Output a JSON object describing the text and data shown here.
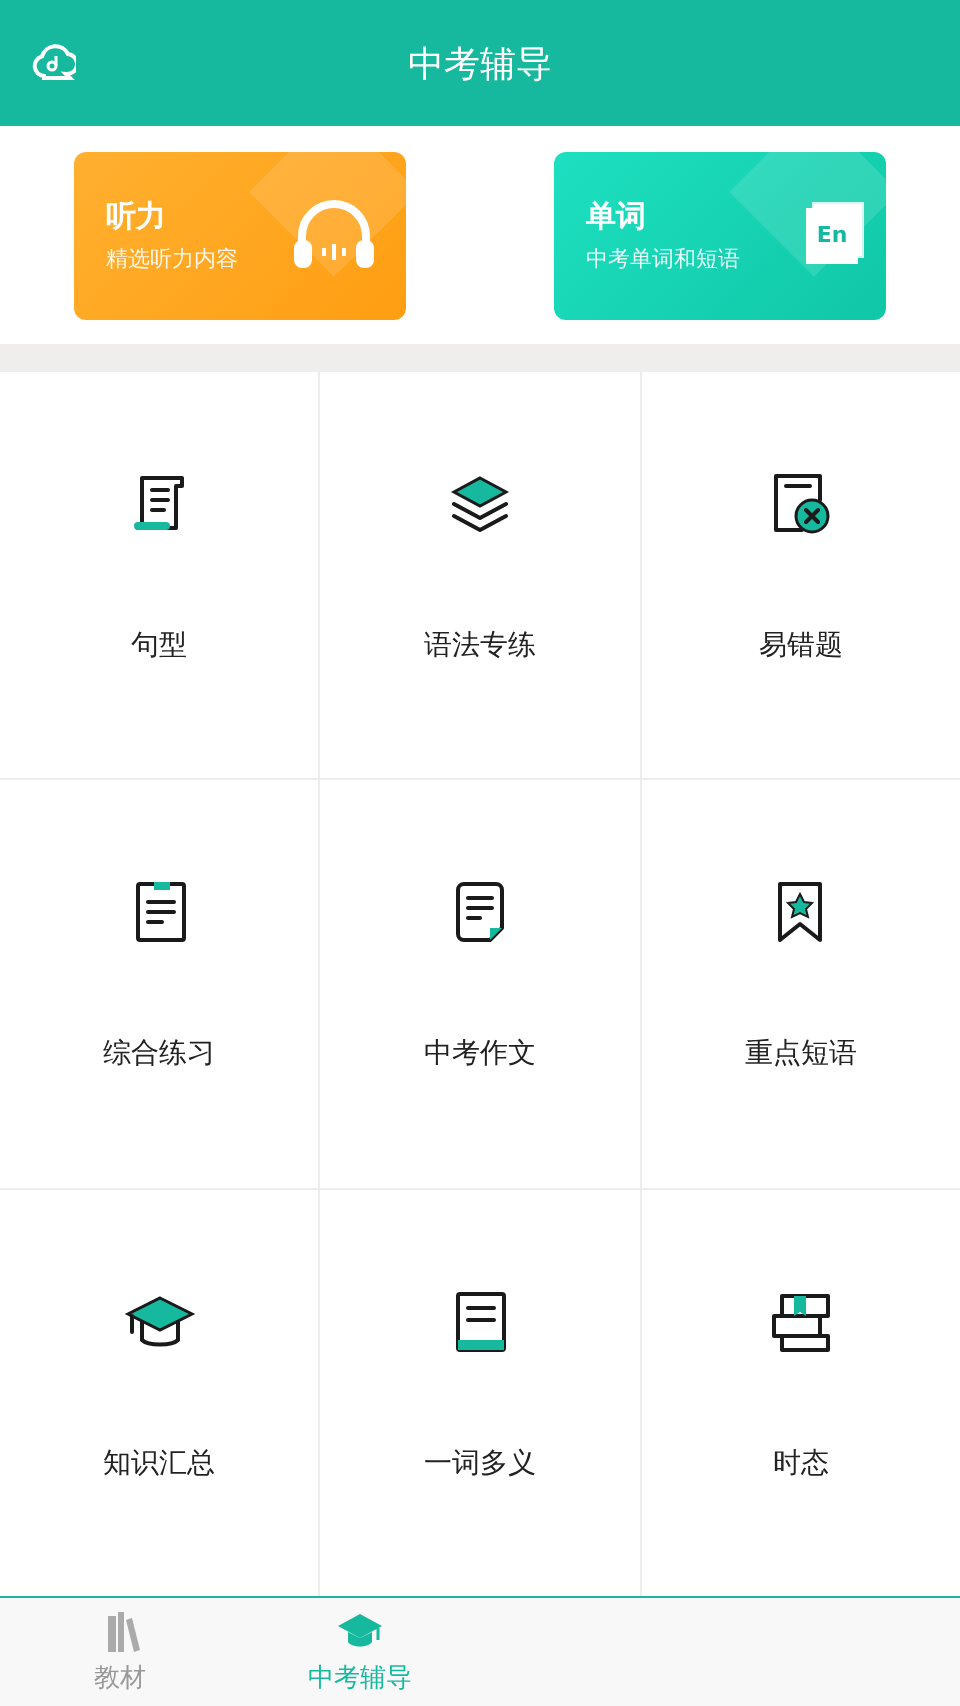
{
  "header": {
    "title": "中考辅导"
  },
  "feature_cards": [
    {
      "kind": "listening",
      "title": "听力",
      "subtitle": "精选听力内容"
    },
    {
      "kind": "words",
      "title": "单词",
      "subtitle": "中考单词和短语",
      "badge": "En"
    }
  ],
  "grid_items": [
    {
      "kind": "scroll",
      "label": "句型"
    },
    {
      "kind": "layers",
      "label": "语法专练"
    },
    {
      "kind": "mistake",
      "label": "易错题"
    },
    {
      "kind": "clipboard",
      "label": "综合练习"
    },
    {
      "kind": "document",
      "label": "中考作文"
    },
    {
      "kind": "bookmark",
      "label": "重点短语"
    },
    {
      "kind": "cap",
      "label": "知识汇总"
    },
    {
      "kind": "book",
      "label": "一词多义"
    },
    {
      "kind": "books",
      "label": "时态"
    }
  ],
  "tab_bar": [
    {
      "kind": "books",
      "label": "教材",
      "selected": false
    },
    {
      "kind": "cap",
      "label": "中考辅导",
      "selected": true
    }
  ]
}
